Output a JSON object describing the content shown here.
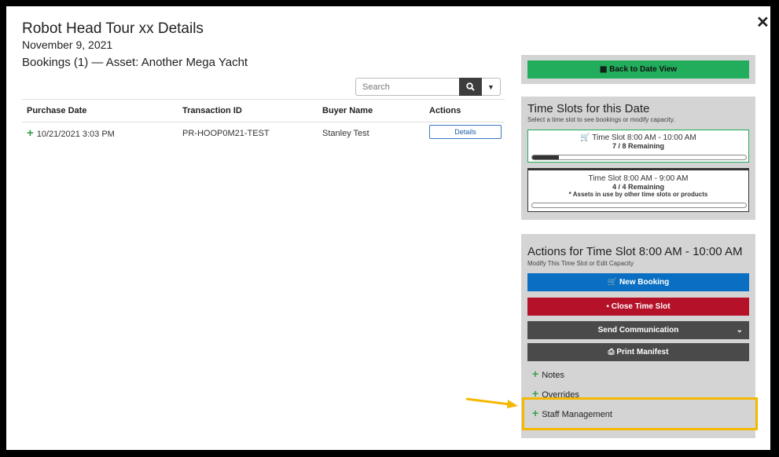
{
  "modal": {
    "title": "Robot Head Tour xx Details",
    "date": "November 9, 2021",
    "bookings_heading": "Bookings (1) — Asset: Another Mega Yacht"
  },
  "search": {
    "placeholder": "Search"
  },
  "table": {
    "headers": [
      "Purchase Date",
      "Transaction ID",
      "Buyer Name",
      "Actions"
    ],
    "rows": [
      {
        "purchase_date": "10/21/2021 3:03 PM",
        "transaction_id": "PR-HOOP0M21-TEST",
        "buyer_name": "Stanley Test",
        "action_label": "Details"
      }
    ]
  },
  "sidebar": {
    "back_label": "Back to Date View",
    "slots_title": "Time Slots for this Date",
    "slots_subtitle": "Select a time slot to see bookings or modify capacity.",
    "slots": [
      {
        "time": "Time Slot 8:00 AM - 10:00 AM",
        "remaining": "7 / 8 Remaining",
        "note": "",
        "fill": 0.125,
        "selected": true
      },
      {
        "time": "Time Slot 8:00 AM - 9:00 AM",
        "remaining": "4 / 4 Remaining",
        "note": "* Assets in use by other time slots or products",
        "fill": 0,
        "selected": false
      }
    ],
    "actions_title": "Actions for Time Slot 8:00 AM - 10:00 AM",
    "actions_subtitle": "Modify This Time Slot or Edit Capacity",
    "buttons": {
      "new_booking": "New Booking",
      "close_slot": "Close Time Slot",
      "send_comm": "Send Communication",
      "print_manifest": "Print Manifest"
    },
    "sections": [
      "Notes",
      "Overrides",
      "Staff Management"
    ]
  },
  "colors": {
    "green": "#22ad5c",
    "blue": "#0a6fc2",
    "red": "#b5122a",
    "dark": "#4a4a4a",
    "highlight": "#f5b800"
  }
}
